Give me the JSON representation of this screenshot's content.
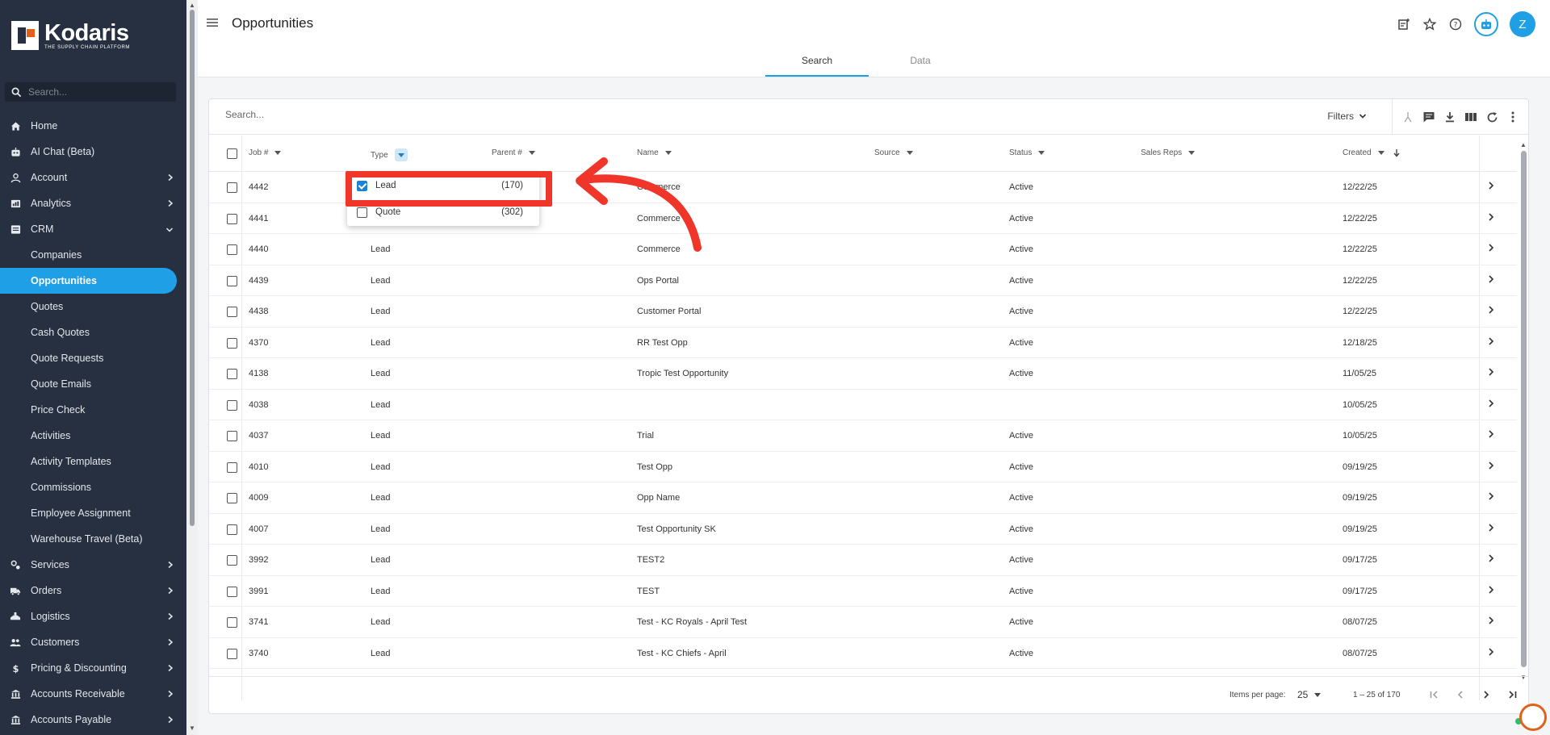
{
  "app": {
    "logo_name": "Kodaris",
    "logo_tag": "THE SUPPLY CHAIN PLATFORM",
    "side_search_placeholder": "Search...",
    "nav": [
      {
        "label": "Home",
        "icon": "home-icon",
        "chevron": false
      },
      {
        "label": "AI Chat (Beta)",
        "icon": "robot-icon",
        "chevron": false
      },
      {
        "label": "Account",
        "icon": "person-icon",
        "chevron": true
      },
      {
        "label": "Analytics",
        "icon": "analytics-icon",
        "chevron": true
      },
      {
        "label": "CRM",
        "icon": "crm-icon",
        "chevron": true,
        "expanded": true
      }
    ],
    "crm_sub": [
      "Companies",
      "Opportunities",
      "Quotes",
      "Cash Quotes",
      "Quote Requests",
      "Quote Emails",
      "Price Check",
      "Activities",
      "Activity Templates",
      "Commissions",
      "Employee Assignment",
      "Warehouse Travel (Beta)"
    ],
    "crm_active": "Opportunities",
    "nav_after": [
      {
        "label": "Services",
        "icon": "services-icon"
      },
      {
        "label": "Orders",
        "icon": "truck-icon"
      },
      {
        "label": "Logistics",
        "icon": "logistics-icon"
      },
      {
        "label": "Customers",
        "icon": "people-icon"
      },
      {
        "label": "Pricing & Discounting",
        "icon": "dollar-icon"
      },
      {
        "label": "Accounts Receivable",
        "icon": "bank-icon"
      },
      {
        "label": "Accounts Payable",
        "icon": "bank-icon"
      }
    ],
    "accent": "#1fa0e6"
  },
  "header": {
    "title": "Opportunities",
    "avatar": "Z",
    "tabs": [
      {
        "label": "Search",
        "active": true
      },
      {
        "label": "Data",
        "active": false
      }
    ]
  },
  "toolbar": {
    "search_placeholder": "Search...",
    "filters_label": "Filters"
  },
  "table": {
    "columns": {
      "job": "Job #",
      "type": "Type",
      "parent": "Parent #",
      "name": "Name",
      "source": "Source",
      "status": "Status",
      "reps": "Sales Reps",
      "created": "Created"
    },
    "rows": [
      {
        "job": "4442",
        "type": "",
        "name": "Commerce",
        "status": "Active",
        "created": "12/22/25"
      },
      {
        "job": "4441",
        "type": "",
        "name": "Commerce",
        "status": "Active",
        "created": "12/22/25"
      },
      {
        "job": "4440",
        "type": "Lead",
        "name": "Commerce",
        "status": "Active",
        "created": "12/22/25"
      },
      {
        "job": "4439",
        "type": "Lead",
        "name": "Ops Portal",
        "status": "Active",
        "created": "12/22/25"
      },
      {
        "job": "4438",
        "type": "Lead",
        "name": "Customer Portal",
        "status": "Active",
        "created": "12/22/25"
      },
      {
        "job": "4370",
        "type": "Lead",
        "name": "RR Test Opp",
        "status": "Active",
        "created": "12/18/25"
      },
      {
        "job": "4138",
        "type": "Lead",
        "name": "Tropic Test Opportunity",
        "status": "Active",
        "created": "11/05/25"
      },
      {
        "job": "4038",
        "type": "Lead",
        "name": "",
        "status": "",
        "created": "10/05/25"
      },
      {
        "job": "4037",
        "type": "Lead",
        "name": "Trial",
        "status": "Active",
        "created": "10/05/25"
      },
      {
        "job": "4010",
        "type": "Lead",
        "name": "Test Opp",
        "status": "Active",
        "created": "09/19/25"
      },
      {
        "job": "4009",
        "type": "Lead",
        "name": "Opp Name",
        "status": "Active",
        "created": "09/19/25"
      },
      {
        "job": "4007",
        "type": "Lead",
        "name": "Test Opportunity SK",
        "status": "Active",
        "created": "09/19/25"
      },
      {
        "job": "3992",
        "type": "Lead",
        "name": "TEST2",
        "status": "Active",
        "created": "09/17/25"
      },
      {
        "job": "3991",
        "type": "Lead",
        "name": "TEST",
        "status": "Active",
        "created": "09/17/25"
      },
      {
        "job": "3741",
        "type": "Lead",
        "name": "Test - KC Royals - April Test",
        "status": "Active",
        "created": "08/07/25"
      },
      {
        "job": "3740",
        "type": "Lead",
        "name": "Test - KC Chiefs - April",
        "status": "Active",
        "created": "08/07/25"
      }
    ]
  },
  "type_filter": {
    "options": [
      {
        "label": "Lead",
        "count": "(170)",
        "checked": true
      },
      {
        "label": "Quote",
        "count": "(302)",
        "checked": false
      }
    ]
  },
  "footer": {
    "items_per_page_label": "Items per page:",
    "items_per_page": "25",
    "range": "1 – 25 of 170"
  }
}
